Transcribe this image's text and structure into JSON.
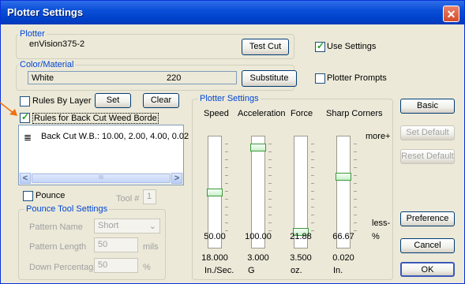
{
  "window": {
    "title": "Plotter Settings",
    "close_glyph": "✕"
  },
  "plotter": {
    "group_label": "Plotter",
    "name": "enVision375-2",
    "test_cut": "Test Cut",
    "use_settings": "Use Settings",
    "use_settings_checked": true
  },
  "color_material": {
    "group_label": "Color/Material",
    "color": "White",
    "number": "220",
    "substitute": "Substitute",
    "plotter_prompts": "Plotter Prompts",
    "plotter_prompts_checked": false
  },
  "layers": {
    "rules_by_layer": "Rules By Layer",
    "set": "Set",
    "clear": "Clear",
    "rules_back_cut": "Rules for Back Cut Weed Borde",
    "rules_back_cut_checked": true
  },
  "rules_list": {
    "items": [
      "Back Cut W.B.: 10.00, 2.00, 4.00, 0.02"
    ],
    "scroll_left": "<",
    "scroll_right": ">",
    "scroll_mid": "III"
  },
  "pounce": {
    "label": "Pounce",
    "checked": false,
    "tool_label": "Tool #",
    "tool_value": "1",
    "group_label": "Pounce Tool Settings",
    "pattern_name_label": "Pattern Name",
    "pattern_name_value": "Short",
    "pattern_length_label": "Pattern Length",
    "pattern_length_value": "50",
    "pattern_length_unit": "mils",
    "down_pct_label": "Down Percentage",
    "down_pct_value": "50",
    "down_pct_unit": "%"
  },
  "plotter_settings": {
    "group_label": "Plotter Settings",
    "headers": [
      "Speed",
      "Acceleration",
      "Force",
      "Sharp Corners"
    ],
    "more": "more+",
    "less": "less-",
    "sliders": [
      {
        "name": "Speed",
        "value": "50.00",
        "level": 0.5,
        "sub": "18.000",
        "unit": "In./Sec."
      },
      {
        "name": "Acceleration",
        "value": "100.00",
        "level": 1.0,
        "sub": "3.000",
        "unit": "G"
      },
      {
        "name": "Force",
        "value": "21.88",
        "level": 0.05,
        "sub": "3.500",
        "unit": "oz."
      },
      {
        "name": "Sharp Corners",
        "value": "66.67",
        "level": 0.67,
        "sub": "0.020",
        "unit": "In."
      }
    ],
    "percent": "%"
  },
  "side_buttons": {
    "basic": "Basic",
    "set_default": "Set Default",
    "reset_default": "Reset Default",
    "preference": "Preference",
    "cancel": "Cancel",
    "ok": "OK"
  }
}
